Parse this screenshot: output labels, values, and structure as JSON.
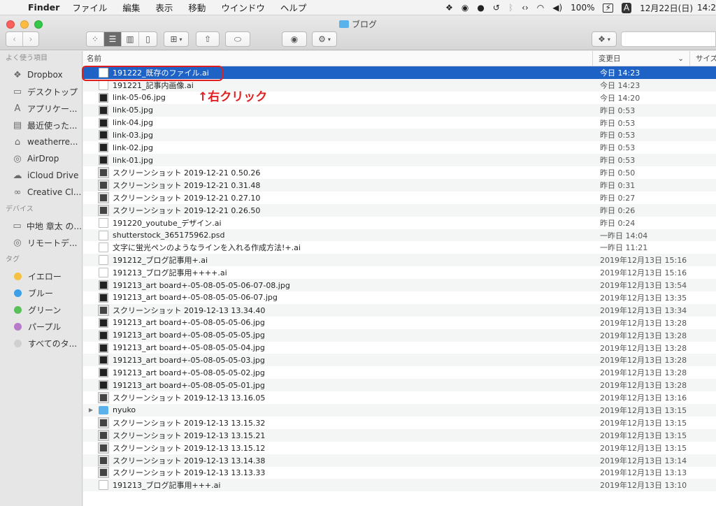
{
  "menubar": {
    "app_name": "Finder",
    "menus": [
      "ファイル",
      "編集",
      "表示",
      "移動",
      "ウインドウ",
      "ヘルプ"
    ],
    "battery": "100%",
    "input_source": "A",
    "datetime": "12月22日(日)",
    "time": "14:2"
  },
  "window": {
    "title": "ブログ"
  },
  "sidebar": {
    "favorites_heading": "よく使う項目",
    "favorites": [
      {
        "label": "Dropbox",
        "icon": "dropbox-icon"
      },
      {
        "label": "デスクトップ",
        "icon": "desktop-icon"
      },
      {
        "label": "アプリケー...",
        "icon": "applications-icon"
      },
      {
        "label": "最近使った...",
        "icon": "recents-icon"
      },
      {
        "label": "weatherre...",
        "icon": "home-icon"
      },
      {
        "label": "AirDrop",
        "icon": "airdrop-icon"
      },
      {
        "label": "iCloud Drive",
        "icon": "icloud-icon"
      },
      {
        "label": "Creative Cl...",
        "icon": "creative-cloud-icon"
      }
    ],
    "devices_heading": "デバイス",
    "devices": [
      {
        "label": "中地 章太 の...",
        "icon": "laptop-icon"
      },
      {
        "label": "リモートデ...",
        "icon": "remote-disc-icon"
      }
    ],
    "tags_heading": "タグ",
    "tags": [
      {
        "label": "イエロー",
        "color": "#f5c142"
      },
      {
        "label": "ブルー",
        "color": "#3d9fe8"
      },
      {
        "label": "グリーン",
        "color": "#5ac05a"
      },
      {
        "label": "パープル",
        "color": "#b77bc9"
      },
      {
        "label": "すべてのタ...",
        "color": "#d0d0d0"
      }
    ]
  },
  "list": {
    "col_name": "名前",
    "col_date": "変更日",
    "col_size": "サイズ",
    "files": [
      {
        "name": "191222_既存のファイル.ai",
        "date": "今日 14:23",
        "type": "doc",
        "selected": true
      },
      {
        "name": "191221_記事内画像.ai",
        "date": "今日 14:23",
        "type": "doc"
      },
      {
        "name": "link-05-06.jpg",
        "date": "今日 14:20",
        "type": "img"
      },
      {
        "name": "link-05.jpg",
        "date": "昨日 0:53",
        "type": "img"
      },
      {
        "name": "link-04.jpg",
        "date": "昨日 0:53",
        "type": "img"
      },
      {
        "name": "link-03.jpg",
        "date": "昨日 0:53",
        "type": "img"
      },
      {
        "name": "link-02.jpg",
        "date": "昨日 0:53",
        "type": "img"
      },
      {
        "name": "link-01.jpg",
        "date": "昨日 0:53",
        "type": "img"
      },
      {
        "name": "スクリーンショット 2019-12-21 0.50.26",
        "date": "昨日 0:50",
        "type": "shot"
      },
      {
        "name": "スクリーンショット 2019-12-21 0.31.48",
        "date": "昨日 0:31",
        "type": "shot"
      },
      {
        "name": "スクリーンショット 2019-12-21 0.27.10",
        "date": "昨日 0:27",
        "type": "shot"
      },
      {
        "name": "スクリーンショット 2019-12-21 0.26.50",
        "date": "昨日 0:26",
        "type": "shot"
      },
      {
        "name": "191220_youtube_デザイン.ai",
        "date": "昨日 0:24",
        "type": "doc"
      },
      {
        "name": "shutterstock_365175962.psd",
        "date": "一昨日 14:04",
        "type": "doc"
      },
      {
        "name": "文字に蛍光ペンのようなラインを入れる作成方法!+.ai",
        "date": "一昨日 11:21",
        "type": "doc"
      },
      {
        "name": "191212_ブログ記事用+.ai",
        "date": "2019年12月13日 15:16",
        "type": "doc"
      },
      {
        "name": "191213_ブログ記事用++++.ai",
        "date": "2019年12月13日 15:16",
        "type": "doc"
      },
      {
        "name": "191213_art board+-05-08-05-05-06-07-08.jpg",
        "date": "2019年12月13日 13:54",
        "type": "img"
      },
      {
        "name": "191213_art board+-05-08-05-05-06-07.jpg",
        "date": "2019年12月13日 13:35",
        "type": "img"
      },
      {
        "name": "スクリーンショット 2019-12-13 13.34.40",
        "date": "2019年12月13日 13:34",
        "type": "shot"
      },
      {
        "name": "191213_art board+-05-08-05-05-06.jpg",
        "date": "2019年12月13日 13:28",
        "type": "img"
      },
      {
        "name": "191213_art board+-05-08-05-05-05.jpg",
        "date": "2019年12月13日 13:28",
        "type": "img"
      },
      {
        "name": "191213_art board+-05-08-05-05-04.jpg",
        "date": "2019年12月13日 13:28",
        "type": "img"
      },
      {
        "name": "191213_art board+-05-08-05-05-03.jpg",
        "date": "2019年12月13日 13:28",
        "type": "img"
      },
      {
        "name": "191213_art board+-05-08-05-05-02.jpg",
        "date": "2019年12月13日 13:28",
        "type": "img"
      },
      {
        "name": "191213_art board+-05-08-05-05-01.jpg",
        "date": "2019年12月13日 13:28",
        "type": "img"
      },
      {
        "name": "スクリーンショット 2019-12-13 13.16.05",
        "date": "2019年12月13日 13:16",
        "type": "shot"
      },
      {
        "name": "nyuko",
        "date": "2019年12月13日 13:15",
        "type": "folder"
      },
      {
        "name": "スクリーンショット 2019-12-13 13.15.32",
        "date": "2019年12月13日 13:15",
        "type": "shot"
      },
      {
        "name": "スクリーンショット 2019-12-13 13.15.21",
        "date": "2019年12月13日 13:15",
        "type": "shot"
      },
      {
        "name": "スクリーンショット 2019-12-13 13.15.12",
        "date": "2019年12月13日 13:15",
        "type": "shot"
      },
      {
        "name": "スクリーンショット 2019-12-13 13.14.38",
        "date": "2019年12月13日 13:14",
        "type": "shot"
      },
      {
        "name": "スクリーンショット 2019-12-13 13.13.33",
        "date": "2019年12月13日 13:13",
        "type": "shot"
      },
      {
        "name": "191213_ブログ記事用+++.ai",
        "date": "2019年12月13日 13:10",
        "type": "doc"
      }
    ]
  },
  "annotation": {
    "text": "↑右クリック",
    "color": "#e02020"
  }
}
